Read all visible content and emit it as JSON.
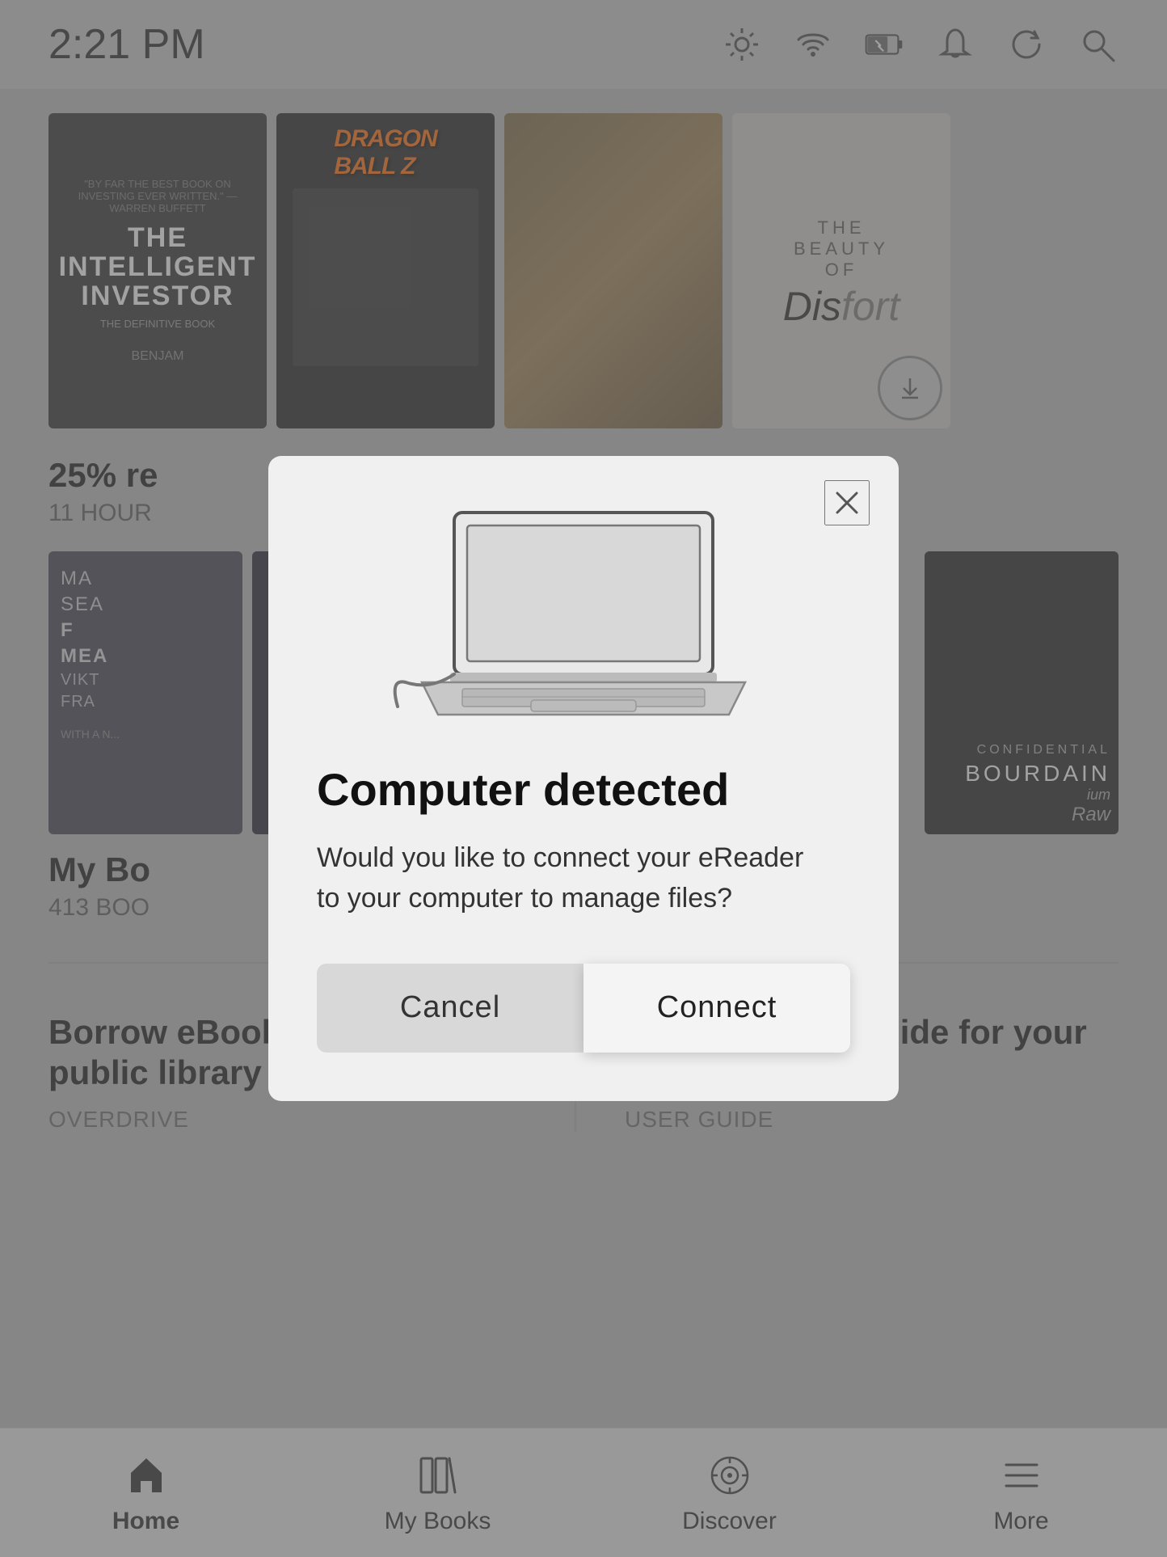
{
  "statusBar": {
    "time": "2:21 PM"
  },
  "books": {
    "topRow": [
      {
        "id": "intelligent-investor",
        "title": "THE INTELLIGENT INVESTOR",
        "subtitle": "THE DEFINITIVE BOOK",
        "author": "BENJAMIN",
        "quote": "\"BY FAR THE BEST BOOK ON INVESTING EVER WRITTEN.\" —WARREN BUFFETT"
      },
      {
        "id": "dragon-ball",
        "title": "DRAGON BALL Z"
      },
      {
        "id": "manga-3",
        "title": ""
      },
      {
        "id": "beauty-of-discomfort",
        "title": "THE BEAUTY OF Discomfort"
      }
    ],
    "topLabel": {
      "title": "25% re",
      "sub": "11 HOUR"
    },
    "bottomRow": [
      {
        "id": "mans-search",
        "authorLines": [
          "MA",
          "SEA",
          "F",
          "MEA",
          "VIKT",
          "FRA"
        ],
        "note": "WITH A N..."
      },
      {
        "id": "manga-bottom",
        "title": ""
      },
      {
        "id": "bourdain",
        "name": "BOURDAIN",
        "subtitle": "ium Raw"
      }
    ],
    "bottomLabel": {
      "title": "My Bo",
      "sub": "413 BOO"
    }
  },
  "linkCards": [
    {
      "title": "Borrow eBooks from your public library",
      "sub": "OVERDRIVE"
    },
    {
      "title": "Read the user guide for your Kobo Forma",
      "sub": "USER GUIDE"
    }
  ],
  "modal": {
    "title": "Computer detected",
    "description": "Would you like to connect your eReader to your computer to manage files?",
    "cancelLabel": "Cancel",
    "connectLabel": "Connect"
  },
  "bottomNav": [
    {
      "id": "home",
      "label": "Home",
      "active": true
    },
    {
      "id": "my-books",
      "label": "My Books",
      "active": false
    },
    {
      "id": "discover",
      "label": "Discover",
      "active": false
    },
    {
      "id": "more",
      "label": "More",
      "active": false
    }
  ]
}
